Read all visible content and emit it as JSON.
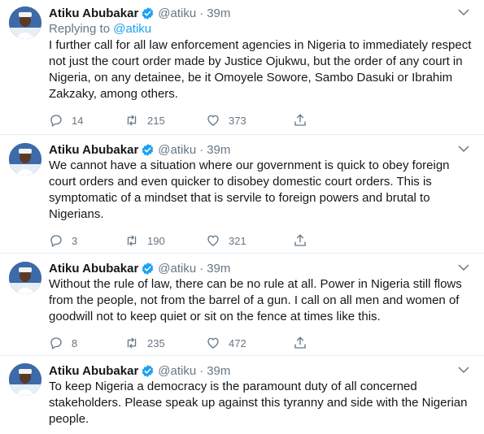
{
  "tweets": [
    {
      "name": "Atiku Abubakar",
      "handle": "@atiku",
      "separator": "·",
      "time": "39m",
      "replying_prefix": "Replying to ",
      "replying_to": "@atiku",
      "text": "I further call for all law enforcement agencies in Nigeria to immediately respect not just the court order made by Justice Ojukwu, but the order of any court in Nigeria, on any detainee, be it Omoyele Sowore, Sambo Dasuki or Ibrahim Zakzaky, among others.",
      "replies": "14",
      "retweets": "215",
      "likes": "373"
    },
    {
      "name": "Atiku Abubakar",
      "handle": "@atiku",
      "separator": "·",
      "time": "39m",
      "text": "We cannot have a situation where our government is quick to obey foreign court orders and even quicker to disobey domestic court orders. This is symptomatic of a mindset that is servile to foreign powers and brutal to Nigerians.",
      "replies": "3",
      "retweets": "190",
      "likes": "321"
    },
    {
      "name": "Atiku Abubakar",
      "handle": "@atiku",
      "separator": "·",
      "time": "39m",
      "text": "Without the rule of law, there can be no rule at all. Power in Nigeria still flows from the people, not from the barrel of a gun. I call on all men and women of goodwill not to keep quiet or sit on the fence at times like this.",
      "replies": "8",
      "retweets": "235",
      "likes": "472"
    },
    {
      "name": "Atiku Abubakar",
      "handle": "@atiku",
      "separator": "·",
      "time": "39m",
      "text": "To keep Nigeria a democracy is the paramount duty of all concerned stakeholders. Please speak up against this tyranny and side with the Nigerian people."
    }
  ],
  "colors": {
    "link": "#1da1f2",
    "secondary_text": "#657786",
    "primary_text": "#14171a",
    "divider": "#e6ecf0"
  },
  "icons": [
    "verified-badge-icon",
    "chevron-down-icon",
    "reply-icon",
    "retweet-icon",
    "like-heart-icon",
    "share-icon"
  ]
}
